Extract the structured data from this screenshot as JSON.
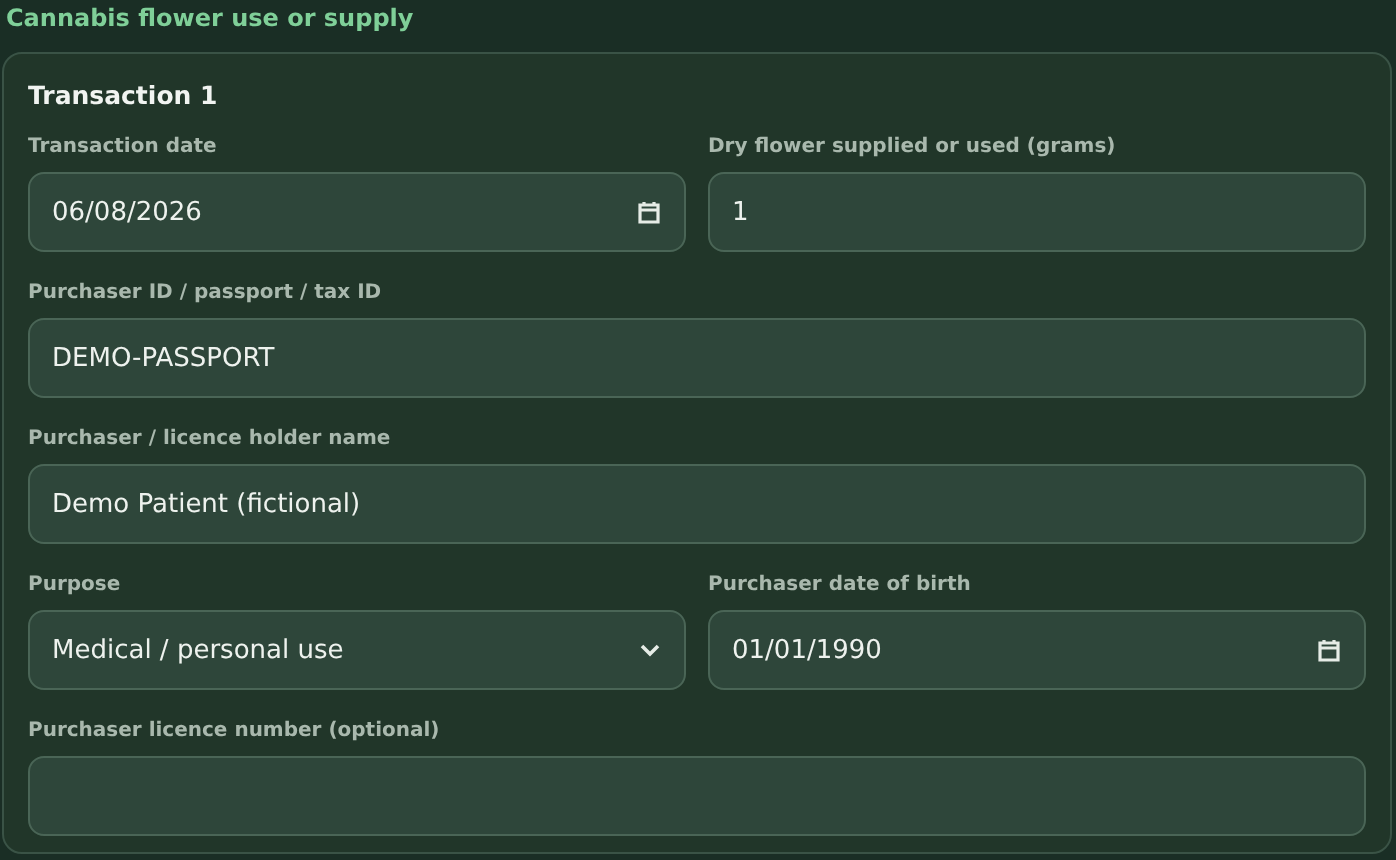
{
  "section_title": "Cannabis flower use or supply",
  "transaction": {
    "title": "Transaction 1",
    "rows": [
      [
        {
          "label": "Transaction date",
          "kind": "date",
          "value": "06/08/2026"
        },
        {
          "label": "Dry flower supplied or used (grams)",
          "kind": "text",
          "value": "1"
        }
      ],
      [
        {
          "label": "Purchaser ID / passport / tax ID",
          "kind": "text",
          "value": "DEMO-PASSPORT"
        }
      ],
      [
        {
          "label": "Purchaser / licence holder name",
          "kind": "text",
          "value": "Demo Patient (fictional)"
        }
      ],
      [
        {
          "label": "Purpose",
          "kind": "select",
          "value": "Medical / personal use"
        },
        {
          "label": "Purchaser date of birth",
          "kind": "date",
          "value": "01/01/1990"
        }
      ],
      [
        {
          "label": "Purchaser licence number (optional)",
          "kind": "text"
        }
      ]
    ]
  }
}
